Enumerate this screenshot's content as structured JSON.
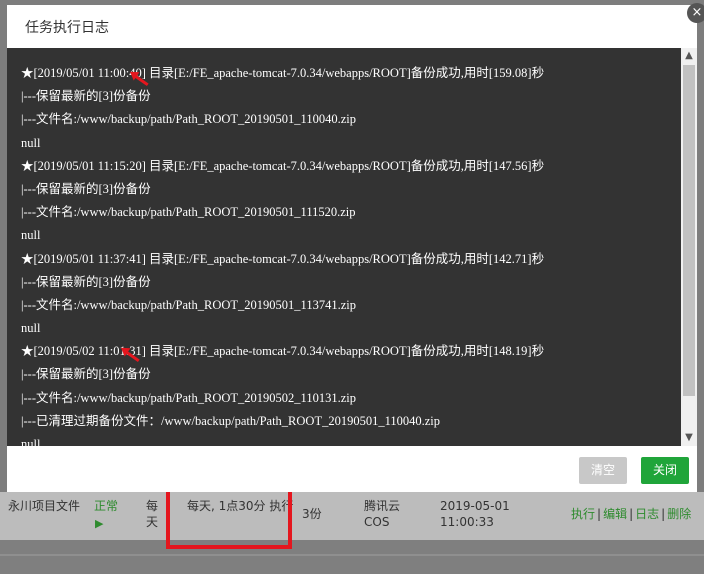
{
  "modal": {
    "title": "任务执行日志",
    "close_icon": "×",
    "log_lines": [
      "★[2019/05/01 11:00:40] 目录[E:/FE_apache-tomcat-7.0.34/webapps/ROOT]备份成功,用时[159.08]秒",
      "|---保留最新的[3]份备份",
      "|---文件名:/www/backup/path/Path_ROOT_20190501_110040.zip",
      "null",
      "★[2019/05/01 11:15:20] 目录[E:/FE_apache-tomcat-7.0.34/webapps/ROOT]备份成功,用时[147.56]秒",
      "|---保留最新的[3]份备份",
      "|---文件名:/www/backup/path/Path_ROOT_20190501_111520.zip",
      "null",
      "★[2019/05/01 11:37:41] 目录[E:/FE_apache-tomcat-7.0.34/webapps/ROOT]备份成功,用时[142.71]秒",
      "|---保留最新的[3]份备份",
      "|---文件名:/www/backup/path/Path_ROOT_20190501_113741.zip",
      "null",
      "★[2019/05/02 11:01:31] 目录[E:/FE_apache-tomcat-7.0.34/webapps/ROOT]备份成功,用时[148.19]秒",
      "|---保留最新的[3]份备份",
      "|---文件名:/www/backup/path/Path_ROOT_20190502_110131.zip",
      "|---已清理过期备份文件：/www/backup/path/Path_ROOT_20190501_110040.zip",
      "null"
    ],
    "scroll_up": "▲",
    "scroll_down": "▼",
    "clear_button": "清空",
    "close_button": "关闭"
  },
  "task_row": {
    "name": "永川项目文件",
    "status": "正常",
    "status_icon": "▶",
    "cycle": "每天",
    "exec_time": "每天, 1点30分 执行",
    "keep_count": "3份",
    "storage": "腾讯云COS",
    "date": "2019-05-01 11:00:33",
    "actions": [
      "执行",
      "编辑",
      "日志",
      "删除"
    ],
    "separator": "|"
  },
  "colors": {
    "accent_green": "#20a53a",
    "highlight_red": "#e4161e",
    "log_background": "#333333"
  }
}
